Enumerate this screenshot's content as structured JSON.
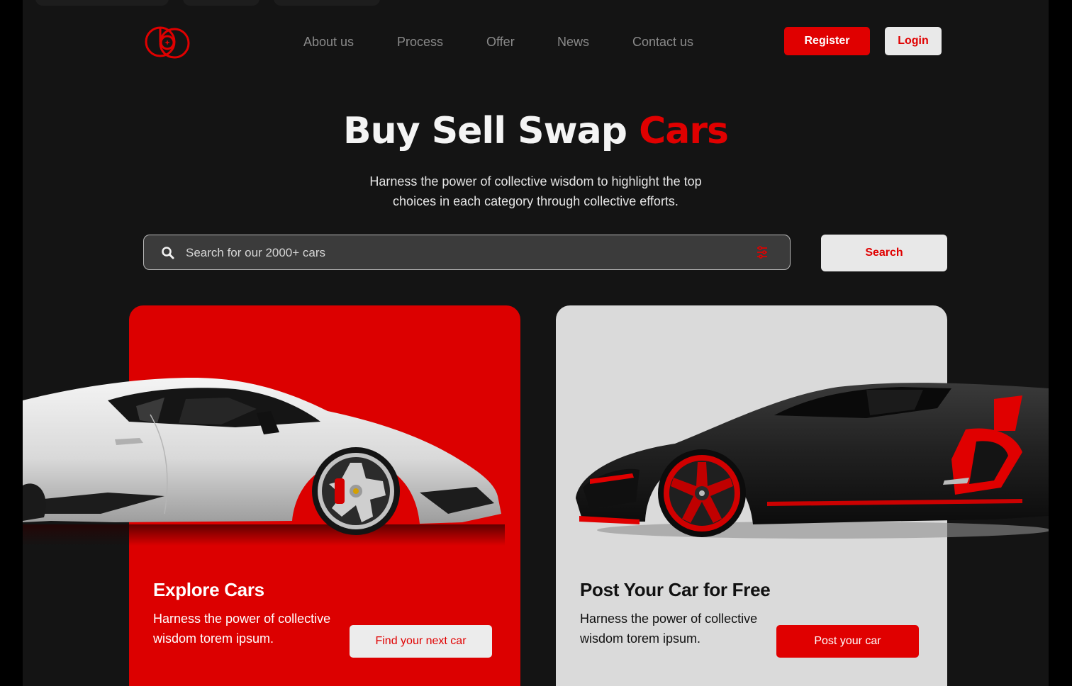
{
  "colors": {
    "accent": "#e00000",
    "background": "#141414",
    "light": "#e9e9e9"
  },
  "header": {
    "logo_icon": "logo-mark",
    "nav": [
      "About us",
      "Process",
      "Offer",
      "News",
      "Contact us"
    ],
    "register_label": "Register",
    "login_label": "Login"
  },
  "hero": {
    "title_main": "Buy Sell Swap",
    "title_accent": "Cars",
    "subtitle_line1": "Harness the power of collective wisdom to highlight the top",
    "subtitle_line2": "choices in each category through collective efforts."
  },
  "search": {
    "placeholder": "Search for our 2000+ cars",
    "search_icon": "search-icon",
    "filter_icon": "filter-icon",
    "button_label": "Search"
  },
  "cards": [
    {
      "title": "Explore Cars",
      "desc": "Harness the power of collective wisdom torem ipsum.",
      "button_label": "Find your next car"
    },
    {
      "title": "Post Your Car for Free",
      "desc": "Harness the power of collective wisdom torem ipsum.",
      "button_label": "Post your car"
    }
  ]
}
